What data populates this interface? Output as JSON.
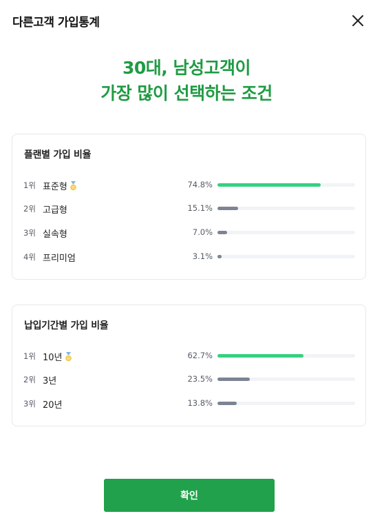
{
  "header": {
    "title": "다른고객 가입통계",
    "close_icon": "close-icon"
  },
  "headline": {
    "line1": "30대, 남성고객이",
    "line2": "가장 많이 선택하는 조건"
  },
  "sections": [
    {
      "title": "플랜별 가입 비율",
      "rows": [
        {
          "rank": "1위",
          "label": "표준형",
          "percent": "74.8%",
          "value": 74.8,
          "top": true
        },
        {
          "rank": "2위",
          "label": "고급형",
          "percent": "15.1%",
          "value": 15.1,
          "top": false
        },
        {
          "rank": "3위",
          "label": "실속형",
          "percent": "7.0%",
          "value": 7.0,
          "top": false
        },
        {
          "rank": "4위",
          "label": "프리미엄",
          "percent": "3.1%",
          "value": 3.1,
          "top": false
        }
      ]
    },
    {
      "title": "납입기간별 가입 비율",
      "rows": [
        {
          "rank": "1위",
          "label": "10년",
          "percent": "62.7%",
          "value": 62.7,
          "top": true
        },
        {
          "rank": "2위",
          "label": "3년",
          "percent": "23.5%",
          "value": 23.5,
          "top": false
        },
        {
          "rank": "3위",
          "label": "20년",
          "percent": "13.8%",
          "value": 13.8,
          "top": false
        }
      ]
    }
  ],
  "colors": {
    "accent": "#21a14b",
    "headline": "#1f9b43",
    "top_bar": "#35d17f",
    "other_bar": "#7c8494",
    "medal": "#f2c94c"
  },
  "confirm_button": {
    "label": "확인"
  }
}
